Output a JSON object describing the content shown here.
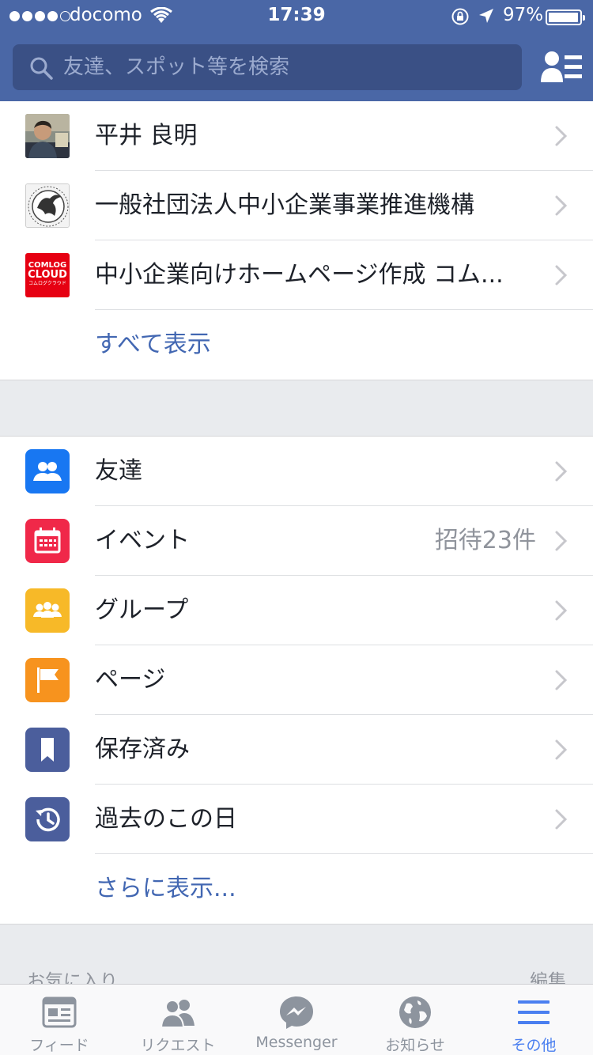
{
  "status_bar": {
    "carrier": "docomo",
    "time": "17:39",
    "battery_pct": "97%"
  },
  "search": {
    "placeholder": "友達、スポット等を検索"
  },
  "recent": {
    "items": [
      {
        "label": "平井 良明",
        "thumb": "person-photo"
      },
      {
        "label": "一般社団法人中小企業事業推進機構",
        "thumb": "pegasus-emblem"
      },
      {
        "label": "中小企業向けホームページ作成 コム...",
        "thumb": "comlog-logo",
        "logo_line1": "COMLOG",
        "logo_line2": "CLOUD",
        "logo_line3": "コムログクラウド"
      }
    ],
    "see_all": "すべて表示"
  },
  "menu": {
    "items": [
      {
        "label": "友達",
        "icon": "friends-icon",
        "color": "#1877f2"
      },
      {
        "label": "イベント",
        "icon": "calendar-icon",
        "color": "#f02849",
        "detail": "招待23件"
      },
      {
        "label": "グループ",
        "icon": "groups-icon",
        "color": "#f7b928"
      },
      {
        "label": "ページ",
        "icon": "flag-icon",
        "color": "#f7931e"
      },
      {
        "label": "保存済み",
        "icon": "bookmark-icon",
        "color": "#4b5e9c"
      },
      {
        "label": "過去のこの日",
        "icon": "history-icon",
        "color": "#4b5e9c"
      }
    ],
    "see_more": "さらに表示..."
  },
  "favorites": {
    "title": "お気に入り",
    "edit": "編集"
  },
  "tabs": [
    {
      "label": "フィード",
      "icon": "newsfeed-icon"
    },
    {
      "label": "リクエスト",
      "icon": "friend-requests-icon"
    },
    {
      "label": "Messenger",
      "icon": "messenger-icon"
    },
    {
      "label": "お知らせ",
      "icon": "notifications-globe-icon"
    },
    {
      "label": "その他",
      "icon": "menu-icon",
      "active": true
    }
  ]
}
